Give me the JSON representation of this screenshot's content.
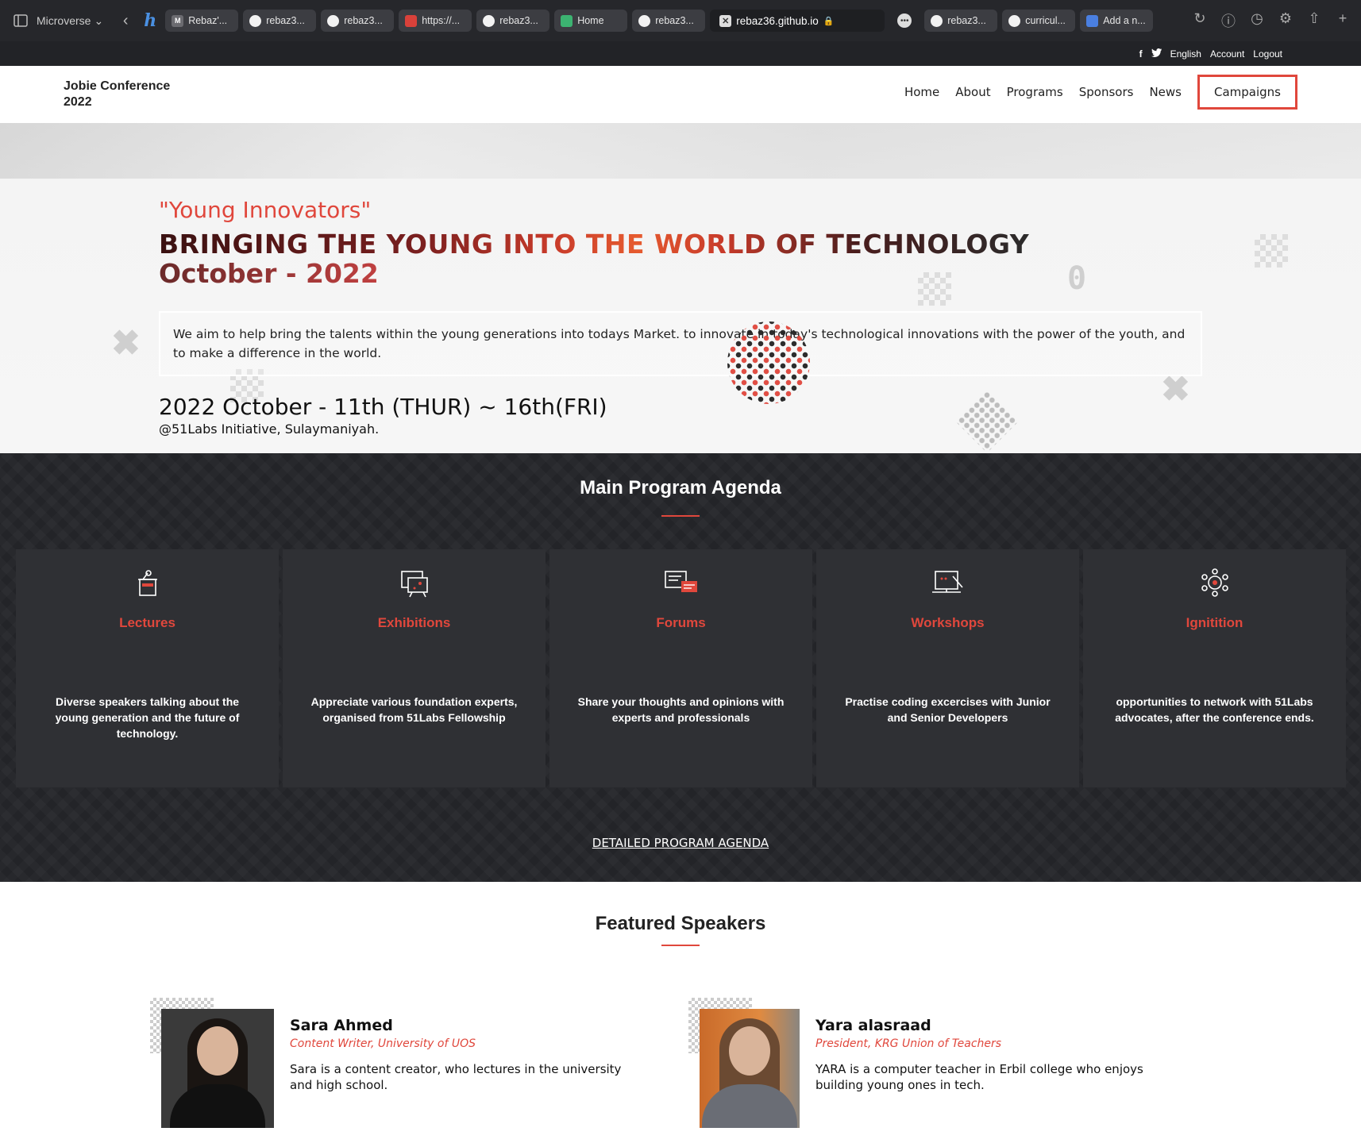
{
  "browser": {
    "profile": "Microverse",
    "tabs": [
      {
        "label": "Rebaz'...",
        "icon": "m-icon"
      },
      {
        "label": "rebaz3...",
        "icon": "github-icon"
      },
      {
        "label": "rebaz3...",
        "icon": "github-icon"
      },
      {
        "label": "https://...",
        "icon": "bookmark-icon"
      },
      {
        "label": "rebaz3...",
        "icon": "github-icon"
      },
      {
        "label": "Home",
        "icon": "site-icon"
      },
      {
        "label": "rebaz3...",
        "icon": "github-icon"
      },
      {
        "label": "rebaz36.github.io",
        "icon": "close-icon",
        "active": true
      },
      {
        "label": "rebaz3...",
        "icon": "github-icon"
      },
      {
        "label": "curricul...",
        "icon": "github-icon"
      },
      {
        "label": "Add a n...",
        "icon": "docs-icon"
      }
    ]
  },
  "utilbar": {
    "facebook": "f",
    "twitter": "t",
    "language": "English",
    "account": "Account",
    "logout": "Logout"
  },
  "nav": {
    "brand_line1": "Jobie Conference",
    "brand_line2": "2022",
    "links": [
      "Home",
      "About",
      "Programs",
      "Sponsors",
      "News",
      "Campaigns"
    ]
  },
  "hero": {
    "tagline": "\"Young Innovators\"",
    "headline": "BRINGING THE YOUNG INTO THE WORLD OF TECHNOLOGY",
    "date_headline": "October - 2022",
    "mission": "We aim to help bring the talents within the young generations into todays Market. to innovate in today's technological innovations with the power of the youth, and to make a difference in the world.",
    "event_date": "2022 October - 11th (THUR) ~ 16th(FRI)",
    "location": "@51Labs Initiative, Sulaymaniyah."
  },
  "agenda": {
    "title": "Main Program Agenda",
    "cards": [
      {
        "icon": "podium-icon",
        "title": "Lectures",
        "desc": "Diverse speakers talking about the young generation and the future of technology."
      },
      {
        "icon": "exhibition-icon",
        "title": "Exhibitions",
        "desc": "Appreciate various foundation experts, organised from 51Labs Fellowship"
      },
      {
        "icon": "forum-icon",
        "title": "Forums",
        "desc": "Share your thoughts and opinions with experts and professionals"
      },
      {
        "icon": "workshop-icon",
        "title": "Workshops",
        "desc": "Practise coding excercises with Junior and Senior Developers"
      },
      {
        "icon": "network-icon",
        "title": "Ignitition",
        "desc": "opportunities to network with 51Labs advocates, after the conference ends."
      }
    ],
    "detail_link": "DETAILED PROGRAM AGENDA"
  },
  "speakers": {
    "title": "Featured Speakers",
    "items": [
      {
        "name": "Sara Ahmed",
        "role": "Content Writer, University of UOS",
        "bio": "Sara is a content creator, who lectures in the university and high school."
      },
      {
        "name": "Yara alasraad",
        "role": "President, KRG Union of Teachers",
        "bio": "YARA is a computer teacher in Erbil college who enjoys building young ones in tech."
      }
    ]
  },
  "colors": {
    "accent": "#e0473c",
    "dark_bg": "#232428",
    "card_bg": "#2f3034"
  }
}
